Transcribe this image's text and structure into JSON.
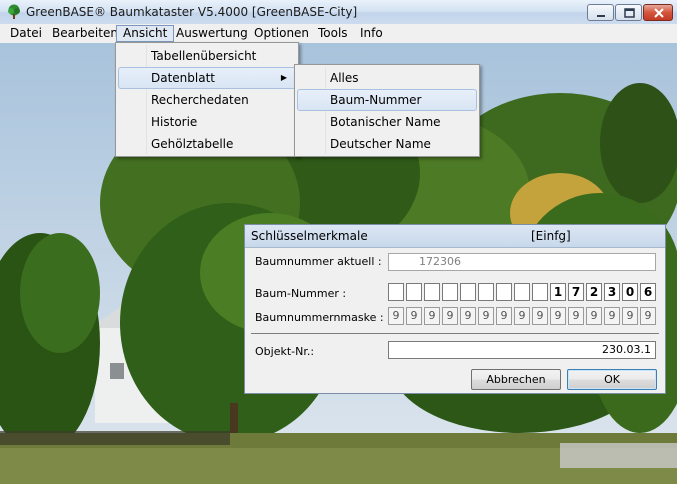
{
  "window": {
    "title": "GreenBASE® Baumkataster V5.4000  [GreenBASE-City]",
    "icon": "tree-icon"
  },
  "menubar": {
    "items": [
      "Datei",
      "Bearbeiten",
      "Ansicht",
      "Auswertung",
      "Optionen",
      "Tools",
      "Info"
    ],
    "active": "Ansicht"
  },
  "ansicht_menu": {
    "items": [
      "Tabellenübersicht",
      "Datenblatt",
      "Recherchedaten",
      "Historie",
      "Gehölztabelle"
    ],
    "highlighted": "Datenblatt"
  },
  "datenblatt_menu": {
    "items": [
      "Alles",
      "Baum-Nummer",
      "Botanischer Name",
      "Deutscher Name"
    ],
    "highlighted": "Baum-Nummer"
  },
  "dialog": {
    "title": "Schlüsselmerkmale",
    "mode": "[Einfg]",
    "current_label": "Baumnummer aktuell :",
    "current_value": "172306",
    "baum_nummer_label": "Baum-Nummer :",
    "baum_nummer_cells": [
      "",
      "",
      "",
      "",
      "",
      "",
      "",
      "",
      "",
      "1",
      "7",
      "2",
      "3",
      "0",
      "6"
    ],
    "mask_label": "Baumnummernmaske :",
    "mask_cells": [
      "9",
      "9",
      "9",
      "9",
      "9",
      "9",
      "9",
      "9",
      "9",
      "9",
      "9",
      "9",
      "9",
      "9",
      "9"
    ],
    "objekt_label": "Objekt-Nr.:",
    "objekt_value": "230.03.1",
    "cancel_label": "Abbrechen",
    "ok_label": "OK"
  }
}
